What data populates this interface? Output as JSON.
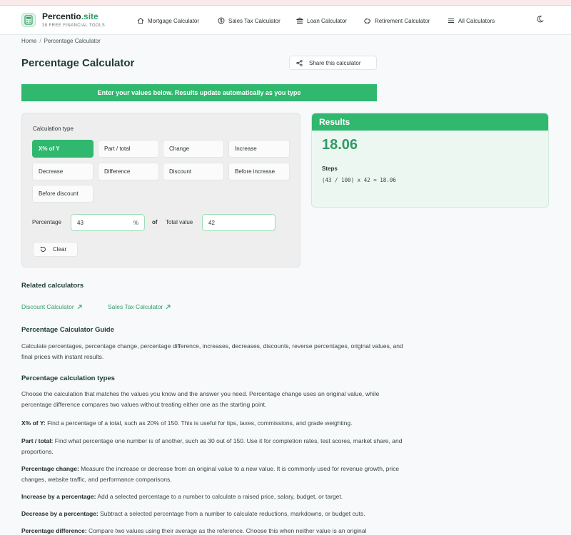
{
  "brand": {
    "name": "Percentio",
    "name_suffix": ".site",
    "tagline": "38 FREE FINANCIAL TOOLS"
  },
  "nav": [
    {
      "label": "Mortgage Calculator",
      "icon": "home-icon"
    },
    {
      "label": "Sales Tax Calculator",
      "icon": "dollar-circle-icon"
    },
    {
      "label": "Loan Calculator",
      "icon": "bank-icon"
    },
    {
      "label": "Retirement Calculator",
      "icon": "piggy-bank-icon"
    },
    {
      "label": "All Calculators",
      "icon": "menu-lines-icon"
    }
  ],
  "breadcrumb": {
    "home": "Home",
    "separator": "/",
    "current": "Percentage Calculator"
  },
  "page": {
    "title": "Percentage Calculator",
    "share_label": "Share this calculator"
  },
  "banner": {
    "text": "Enter your values below. Results update automatically as you type"
  },
  "calculator": {
    "type_label": "Calculation type",
    "types": [
      "X% of Y",
      "Part / total",
      "Change",
      "Increase",
      "Decrease",
      "Difference",
      "Discount",
      "Before increase",
      "Before discount"
    ],
    "active_type": "X% of Y",
    "percentage_label": "Percentage",
    "percentage_value": "43",
    "percentage_unit": "%",
    "of_label": "of",
    "total_label": "Total value",
    "total_value": "42",
    "clear_label": "Clear"
  },
  "results": {
    "heading": "Results",
    "value": "18.06",
    "steps_label": "Steps",
    "steps_text": "(43 / 100) x 42 = 18.06"
  },
  "related": {
    "heading": "Related calculators",
    "links": [
      "Discount Calculator",
      "Sales Tax Calculator"
    ]
  },
  "guide": {
    "heading": "Percentage Calculator Guide",
    "intro": "Calculate percentages, percentage change, percentage difference, increases, decreases, discounts, reverse percentages, original values, and final prices with instant results."
  },
  "types_section": {
    "heading": "Percentage calculation types",
    "intro": "Choose the calculation that matches the values you know and the answer you need. Percentage change uses an original value, while percentage difference compares two values without treating either one as the starting point.",
    "items": [
      {
        "term": "X% of Y:",
        "desc": " Find a percentage of a total, such as 20% of 150. This is useful for tips, taxes, commissions, and grade weighting."
      },
      {
        "term": "Part / total:",
        "desc": " Find what percentage one number is of another, such as 30 out of 150. Use it for completion rates, test scores, market share, and proportions."
      },
      {
        "term": "Percentage change:",
        "desc": " Measure the increase or decrease from an original value to a new value. It is commonly used for revenue growth, price changes, website traffic, and performance comparisons."
      },
      {
        "term": "Increase by a percentage:",
        "desc": " Add a selected percentage to a number to calculate a raised price, salary, budget, or target."
      },
      {
        "term": "Decrease by a percentage:",
        "desc": " Subtract a selected percentage from a number to calculate reductions, markdowns, or budget cuts."
      },
      {
        "term": "Percentage difference:",
        "desc": " Compare two values using their average as the reference. Choose this when neither value is an original"
      }
    ]
  },
  "colors": {
    "accent": "#2fb86e",
    "accent_text": "#2e9c63",
    "heading": "#1d3b2e"
  }
}
